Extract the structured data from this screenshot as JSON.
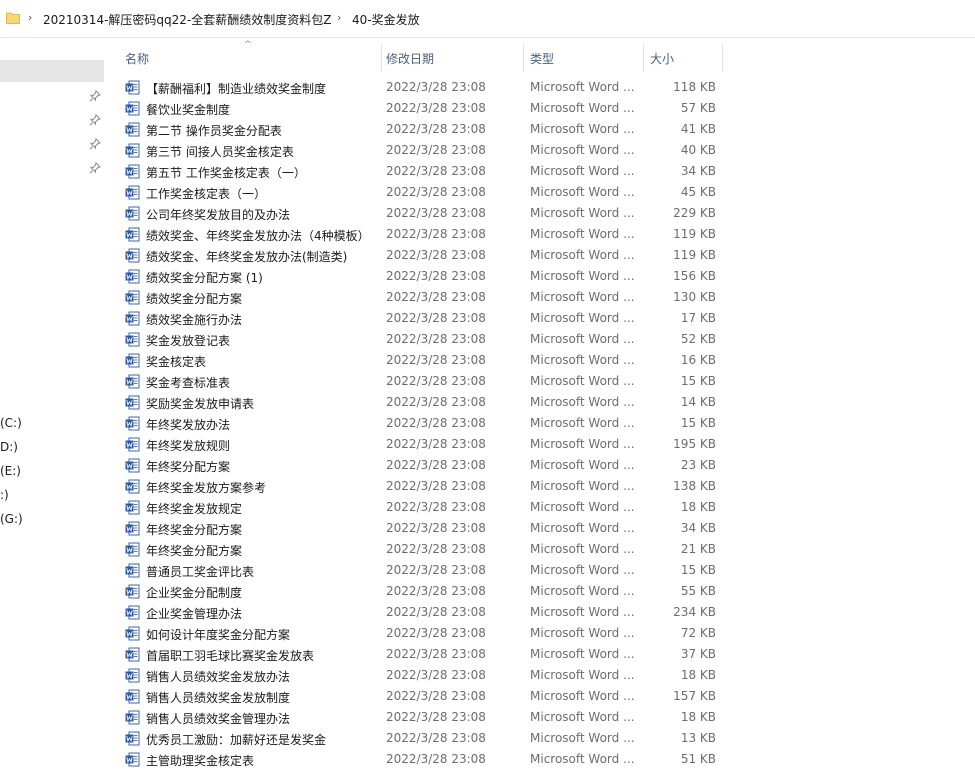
{
  "breadcrumb": {
    "items": [
      "20210314-解压密码qq22-全套薪酬绩效制度资料包Z",
      "40-奖金发放"
    ]
  },
  "nav": {
    "drives": [
      "(C:)",
      "D:)",
      "(E:)",
      ":)",
      "(G:)"
    ]
  },
  "columns": {
    "name": "名称",
    "date": "修改日期",
    "type": "类型",
    "size": "大小"
  },
  "colors": {
    "accent_blue": "#2b579a",
    "header_text": "#4c607a",
    "folder_yellow": "#f8d775",
    "selected_bg": "#e5e5e5"
  },
  "files": [
    {
      "name": "【薪酬福利】制造业绩效奖金制度",
      "date": "2022/3/28 23:08",
      "type": "Microsoft Word ...",
      "size": "118 KB"
    },
    {
      "name": "餐饮业奖金制度",
      "date": "2022/3/28 23:08",
      "type": "Microsoft Word ...",
      "size": "57 KB"
    },
    {
      "name": "第二节 操作员奖金分配表",
      "date": "2022/3/28 23:08",
      "type": "Microsoft Word ...",
      "size": "41 KB"
    },
    {
      "name": "第三节 间接人员奖金核定表",
      "date": "2022/3/28 23:08",
      "type": "Microsoft Word ...",
      "size": "40 KB"
    },
    {
      "name": "第五节 工作奖金核定表（一）",
      "date": "2022/3/28 23:08",
      "type": "Microsoft Word ...",
      "size": "34 KB"
    },
    {
      "name": "工作奖金核定表（一）",
      "date": "2022/3/28 23:08",
      "type": "Microsoft Word ...",
      "size": "45 KB"
    },
    {
      "name": "公司年终奖发放目的及办法",
      "date": "2022/3/28 23:08",
      "type": "Microsoft Word ...",
      "size": "229 KB"
    },
    {
      "name": "绩效奖金、年终奖金发放办法（4种模板）",
      "date": "2022/3/28 23:08",
      "type": "Microsoft Word ...",
      "size": "119 KB"
    },
    {
      "name": "绩效奖金、年终奖金发放办法(制造类)",
      "date": "2022/3/28 23:08",
      "type": "Microsoft Word ...",
      "size": "119 KB"
    },
    {
      "name": "绩效奖金分配方案 (1)",
      "date": "2022/3/28 23:08",
      "type": "Microsoft Word ...",
      "size": "156 KB"
    },
    {
      "name": "绩效奖金分配方案",
      "date": "2022/3/28 23:08",
      "type": "Microsoft Word ...",
      "size": "130 KB"
    },
    {
      "name": "绩效奖金施行办法",
      "date": "2022/3/28 23:08",
      "type": "Microsoft Word ...",
      "size": "17 KB"
    },
    {
      "name": "奖金发放登记表",
      "date": "2022/3/28 23:08",
      "type": "Microsoft Word ...",
      "size": "52 KB"
    },
    {
      "name": "奖金核定表",
      "date": "2022/3/28 23:08",
      "type": "Microsoft Word ...",
      "size": "16 KB"
    },
    {
      "name": "奖金考查标准表",
      "date": "2022/3/28 23:08",
      "type": "Microsoft Word ...",
      "size": "15 KB"
    },
    {
      "name": "奖励奖金发放申请表",
      "date": "2022/3/28 23:08",
      "type": "Microsoft Word ...",
      "size": "14 KB"
    },
    {
      "name": "年终奖发放办法",
      "date": "2022/3/28 23:08",
      "type": "Microsoft Word ...",
      "size": "15 KB"
    },
    {
      "name": "年终奖发放规则",
      "date": "2022/3/28 23:08",
      "type": "Microsoft Word ...",
      "size": "195 KB"
    },
    {
      "name": "年终奖分配方案",
      "date": "2022/3/28 23:08",
      "type": "Microsoft Word ...",
      "size": "23 KB"
    },
    {
      "name": "年终奖金发放方案参考",
      "date": "2022/3/28 23:08",
      "type": "Microsoft Word ...",
      "size": "138 KB"
    },
    {
      "name": "年终奖金发放规定",
      "date": "2022/3/28 23:08",
      "type": "Microsoft Word ...",
      "size": "18 KB"
    },
    {
      "name": "年终奖金分配方案",
      "date": "2022/3/28 23:08",
      "type": "Microsoft Word ...",
      "size": "34 KB"
    },
    {
      "name": "年终奖金分配方案",
      "date": "2022/3/28 23:08",
      "type": "Microsoft Word ...",
      "size": "21 KB"
    },
    {
      "name": "普通员工奖金评比表",
      "date": "2022/3/28 23:08",
      "type": "Microsoft Word ...",
      "size": "15 KB"
    },
    {
      "name": "企业奖金分配制度",
      "date": "2022/3/28 23:08",
      "type": "Microsoft Word ...",
      "size": "55 KB"
    },
    {
      "name": "企业奖金管理办法",
      "date": "2022/3/28 23:08",
      "type": "Microsoft Word ...",
      "size": "234 KB"
    },
    {
      "name": "如何设计年度奖金分配方案",
      "date": "2022/3/28 23:08",
      "type": "Microsoft Word ...",
      "size": "72 KB"
    },
    {
      "name": "首届职工羽毛球比赛奖金发放表",
      "date": "2022/3/28 23:08",
      "type": "Microsoft Word ...",
      "size": "37 KB"
    },
    {
      "name": "销售人员绩效奖金发放办法",
      "date": "2022/3/28 23:08",
      "type": "Microsoft Word ...",
      "size": "18 KB"
    },
    {
      "name": "销售人员绩效奖金发放制度",
      "date": "2022/3/28 23:08",
      "type": "Microsoft Word ...",
      "size": "157 KB"
    },
    {
      "name": "销售人员绩效奖金管理办法",
      "date": "2022/3/28 23:08",
      "type": "Microsoft Word ...",
      "size": "18 KB"
    },
    {
      "name": "优秀员工激励：加薪好还是发奖金",
      "date": "2022/3/28 23:08",
      "type": "Microsoft Word ...",
      "size": "13 KB"
    },
    {
      "name": "主管助理奖金核定表",
      "date": "2022/3/28 23:08",
      "type": "Microsoft Word ...",
      "size": "51 KB"
    }
  ]
}
